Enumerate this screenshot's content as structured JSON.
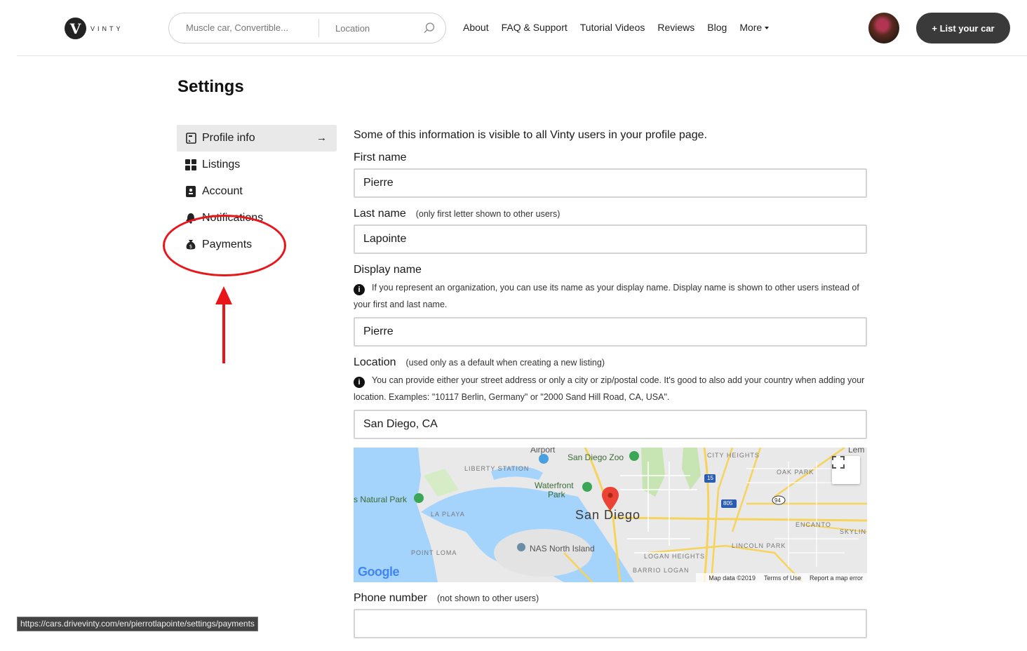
{
  "brand": {
    "logo_letter": "V",
    "logo_text": "VINTY"
  },
  "search": {
    "query_placeholder": "Muscle car, Convertible...",
    "location_placeholder": "Location"
  },
  "nav": {
    "items": [
      "About",
      "FAQ & Support",
      "Tutorial Videos",
      "Reviews",
      "Blog",
      "More"
    ]
  },
  "header": {
    "list_car_label": "+ List your car"
  },
  "page": {
    "title": "Settings"
  },
  "sidebar": {
    "items": [
      {
        "label": "Profile info",
        "icon": "profile-icon",
        "active": true
      },
      {
        "label": "Listings",
        "icon": "grid-icon"
      },
      {
        "label": "Account",
        "icon": "account-icon"
      },
      {
        "label": "Notifications",
        "icon": "bell-icon"
      },
      {
        "label": "Payments",
        "icon": "money-bag-icon"
      }
    ],
    "active_arrow": "→"
  },
  "form": {
    "intro": "Some of this information is visible to all Vinty users in your profile page.",
    "first_name": {
      "label": "First name",
      "value": "Pierre"
    },
    "last_name": {
      "label": "Last name",
      "sub": "(only first letter shown to other users)",
      "value": "Lapointe"
    },
    "display_name": {
      "label": "Display name",
      "info": "If you represent an organization, you can use its name as your display name. Display name is shown to other users instead of your first and last name.",
      "value": "Pierre"
    },
    "location": {
      "label": "Location",
      "sub": "(used only as a default when creating a new listing)",
      "info": "You can provide either your street address or only a city or zip/postal code. It's good to also add your country when adding your location. Examples: \"10117 Berlin, Germany\" or \"2000 Sand Hill Road, CA, USA\".",
      "value": "San Diego, CA"
    },
    "phone": {
      "label": "Phone number",
      "sub": "(not shown to other users)",
      "value": ""
    }
  },
  "map": {
    "labels": {
      "airport": "Airport",
      "zoo": "San Diego Zoo",
      "liberty": "LIBERTY STATION",
      "waterfront": "Waterfront",
      "park": "Park",
      "natural_park": "s Natural Park",
      "la_playa": "LA PLAYA",
      "san_diego": "San Diego",
      "nas": "NAS North Island",
      "point_loma": "POINT LOMA",
      "city_heights": "CITY HEIGHTS",
      "oak_park": "OAK PARK",
      "lemon": "Lem",
      "encanto": "ENCANTO",
      "skyline": "SKYLIN",
      "lincoln_park": "LINCOLN PARK",
      "logan_heights": "LOGAN HEIGHTS",
      "barrio_logan": "BARRIO LOGAN",
      "hwy15": "15",
      "hwy805": "805",
      "hwy94": "94"
    },
    "google": "Google",
    "footer": {
      "data": "Map data ©2019",
      "terms": "Terms of Use",
      "report": "Report a map error"
    }
  },
  "status_bar": {
    "url": "https://cars.drivevinty.com/en/pierrotlapointe/settings/payments"
  }
}
